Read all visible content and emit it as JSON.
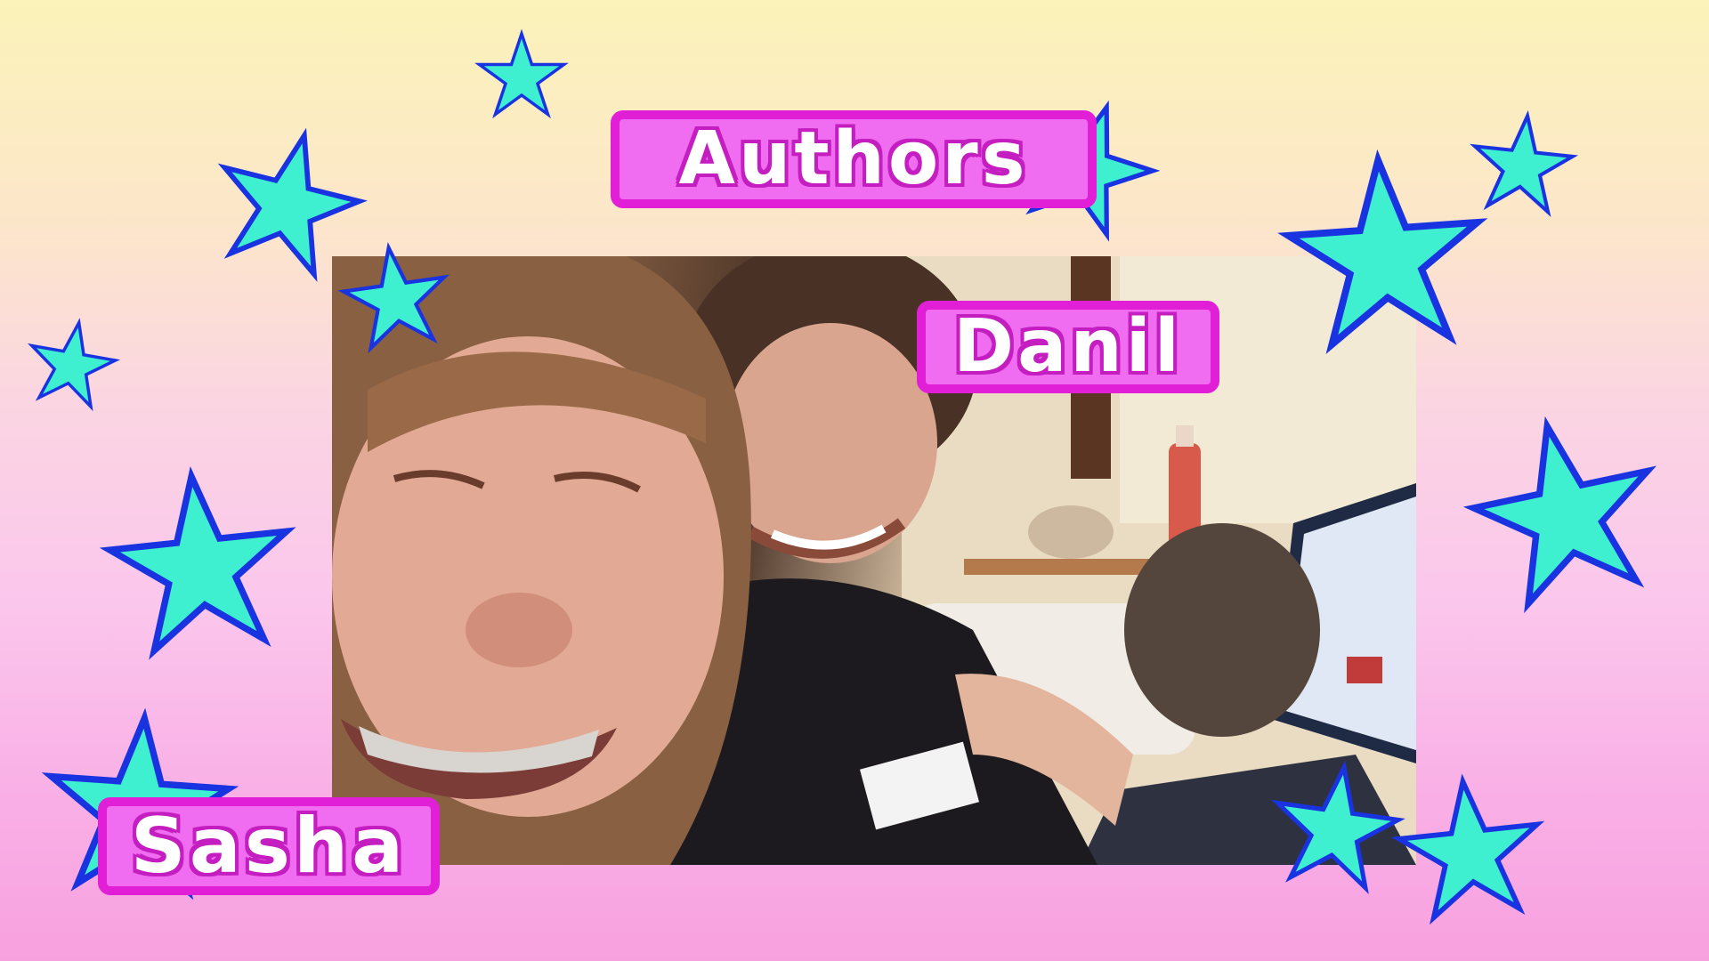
{
  "screen": {
    "title": "Authors",
    "authors": [
      {
        "name": "Danil"
      },
      {
        "name": "Sasha"
      }
    ]
  },
  "photo": {
    "description_visible": false
  },
  "colors": {
    "background_top": "#fbf3b9",
    "background_bottom": "#f8a1df",
    "star_fill": "#3ff0d0",
    "star_outline": "#1a33e0",
    "label_fill": "#f06cf0",
    "label_border": "#e11fd6",
    "label_text": "#ffffff"
  },
  "icons": {
    "decoration": "star-icon"
  }
}
